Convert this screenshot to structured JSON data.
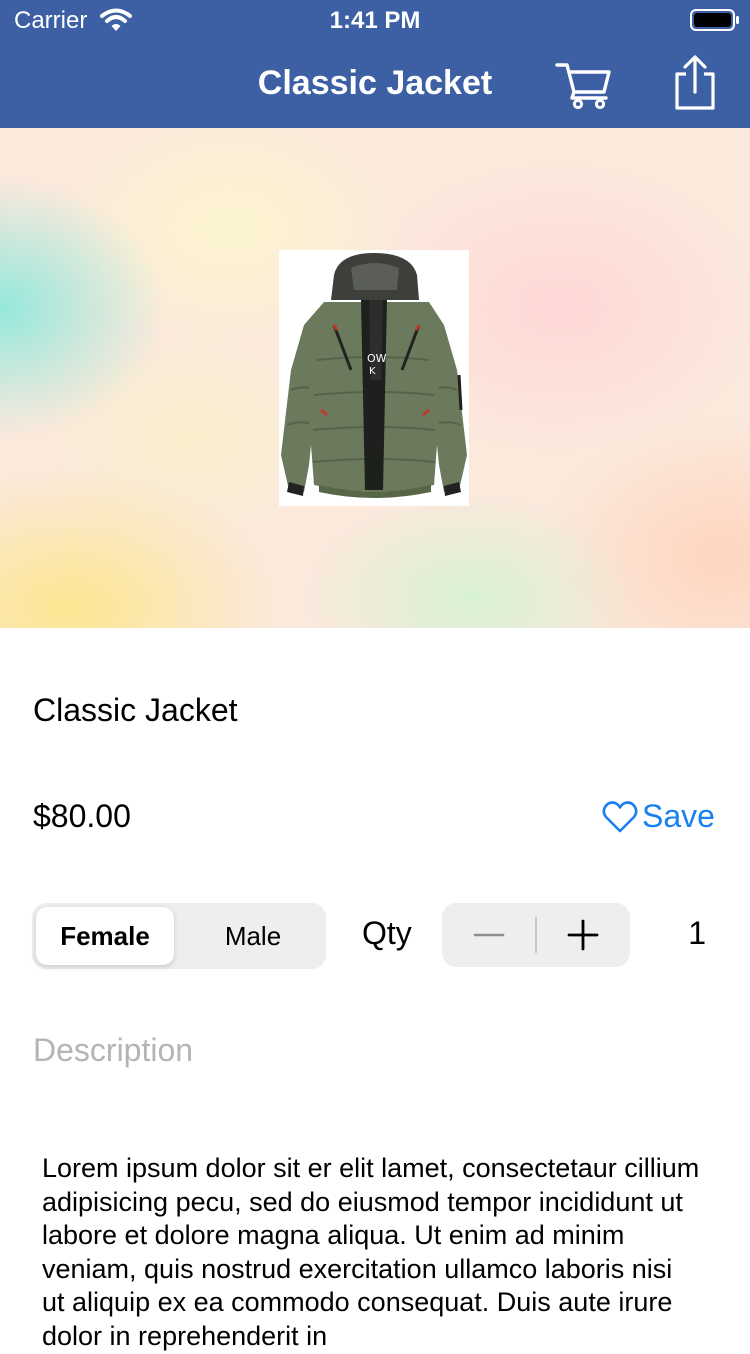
{
  "status_bar": {
    "carrier": "Carrier",
    "time": "1:41 PM"
  },
  "nav": {
    "title": "Classic Jacket",
    "cart_icon": "cart-icon",
    "share_icon": "share-icon"
  },
  "product": {
    "title": "Classic Jacket",
    "price": "$80.00",
    "save_label": "Save",
    "save_icon": "heart-icon",
    "image": "jacket-image"
  },
  "options": {
    "gender_segments": [
      "Female",
      "Male"
    ],
    "selected_gender": "Female",
    "qty_label": "Qty",
    "qty_value": "1"
  },
  "description": {
    "label": "Description",
    "text": "Lorem ipsum dolor sit er elit lamet, consectetaur cillium adipisicing pecu, sed do eiusmod tempor incididunt ut labore et dolore magna aliqua. Ut enim ad minim veniam, quis nostrud exercitation ullamco laboris nisi ut aliquip ex ea commodo consequat. Duis aute irure dolor in reprehenderit in"
  },
  "colors": {
    "nav_background": "#3d60a5",
    "accent": "#1a7ff0",
    "placeholder_gray": "#b4b4b8"
  }
}
